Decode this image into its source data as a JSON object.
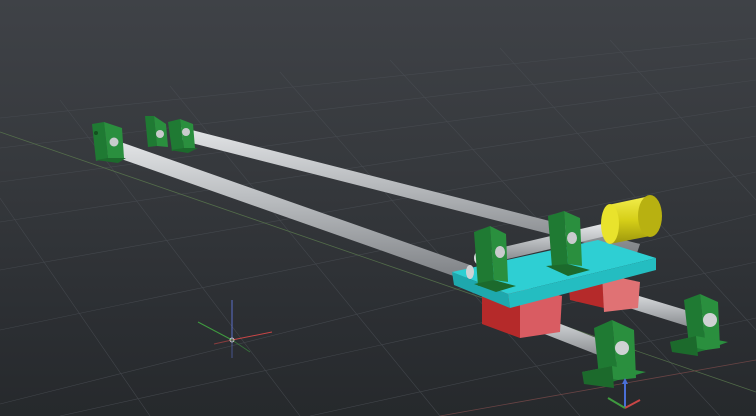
{
  "viewport": {
    "corner_label": "",
    "background_top": "#3f4247",
    "background_bottom": "#26292c",
    "grid_color": "#4a4e54",
    "axis_x_color": "#c84646",
    "axis_y_color": "#3f9a3f",
    "axis_z_color": "#4a6fd8"
  },
  "model": {
    "parts": [
      {
        "name": "rail-rod-back",
        "kind": "shaft",
        "color": "#b9bcbf"
      },
      {
        "name": "rail-rod-front",
        "kind": "shaft",
        "color": "#b9bcbf"
      },
      {
        "name": "lead-screw",
        "kind": "shaft",
        "color": "#b9bcbf"
      },
      {
        "name": "carriage-plate",
        "kind": "plate",
        "color": "#2ecfd3"
      },
      {
        "name": "linear-bearing-block-left",
        "kind": "block",
        "color": "#d95c62"
      },
      {
        "name": "linear-bearing-block-right",
        "kind": "block",
        "color": "#d95c62"
      },
      {
        "name": "shaft-support",
        "kind": "support",
        "color": "#2a8f3e"
      },
      {
        "name": "motor",
        "kind": "cylinder",
        "color": "#d8d21a"
      }
    ]
  }
}
